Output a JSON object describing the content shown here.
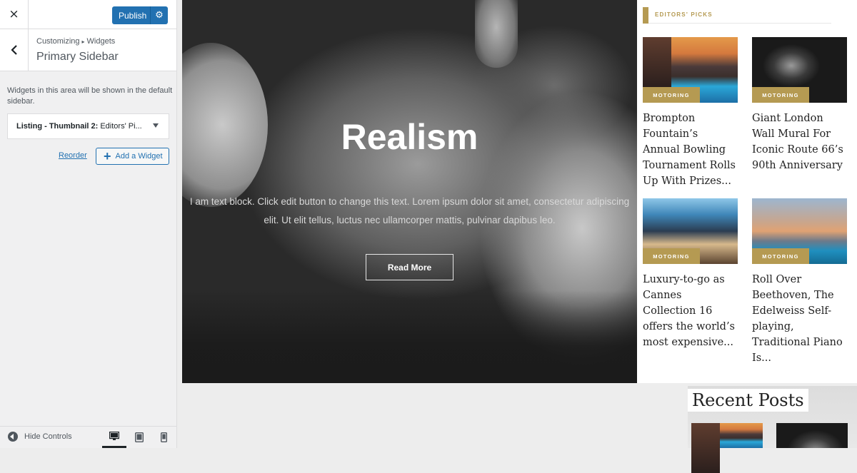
{
  "customizer": {
    "close_icon": "×",
    "publish_label": "Publish",
    "breadcrumb_root": "Customizing",
    "breadcrumb_sep": "▸",
    "breadcrumb_leaf": "Widgets",
    "section_title": "Primary Sidebar",
    "description": "Widgets in this area will be shown in the default sidebar.",
    "widget": {
      "title": "Listing - Thumbnail 2:",
      "subtitle": "Editors' Pi..."
    },
    "reorder_label": "Reorder",
    "add_widget_label": "Add a Widget",
    "add_icon": "+",
    "hide_controls_label": "Hide Controls",
    "accent": "#2271b1"
  },
  "hero": {
    "title": "Realism",
    "text": "I am text block. Click edit button to change this text. Lorem ipsum dolor sit amet, consectetur adipiscing elit. Ut elit tellus, luctus nec ullamcorper mattis, pulvinar dapibus leo.",
    "button_label": "Read More"
  },
  "editors_picks": {
    "heading": "EDITORS' PICKS",
    "accent": "#b59a52",
    "items": [
      {
        "tag": "MOTORING",
        "title": "Brompton Fountain’s Annual Bowling Tournament Rolls Up With Prizes..."
      },
      {
        "tag": "MOTORING",
        "title": "Giant London Wall Mural For Iconic Route 66’s 90th Anniversary"
      },
      {
        "tag": "MOTORING",
        "title": "Luxury-to-go as Cannes Collection 16 offers the world’s most expensive..."
      },
      {
        "tag": "MOTORING",
        "title": "Roll Over Beethoven, The Edelweiss Self-playing, Traditional Piano Is..."
      }
    ]
  },
  "recent_posts": {
    "heading": "Recent Posts"
  }
}
